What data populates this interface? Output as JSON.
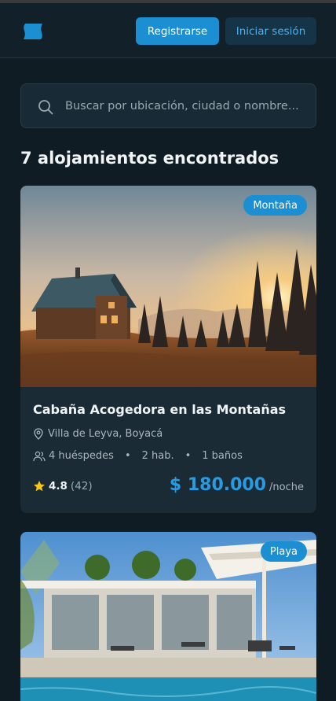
{
  "header": {
    "logo_icon": "blue-flag-logo",
    "register_label": "Registrarse",
    "login_label": "Iniciar sesión"
  },
  "search": {
    "placeholder": "Buscar por ubicación, ciudad o nombre..."
  },
  "results": {
    "title": "7 alojamientos encontrados"
  },
  "listings": [
    {
      "badge": "Montaña",
      "title": "Cabaña Acogedora en las Montañas",
      "location": "Villa de Leyva, Boyacá",
      "guests": "4 huéspedes",
      "rooms": "2 hab.",
      "baths": "1 baños",
      "rating": "4.8",
      "reviews": "(42)",
      "price": "$ 180.000",
      "price_unit": "/noche"
    },
    {
      "badge": "Playa"
    }
  ],
  "colors": {
    "accent": "#1b8fd1",
    "price": "#2a9be0",
    "star": "#f5c518"
  }
}
